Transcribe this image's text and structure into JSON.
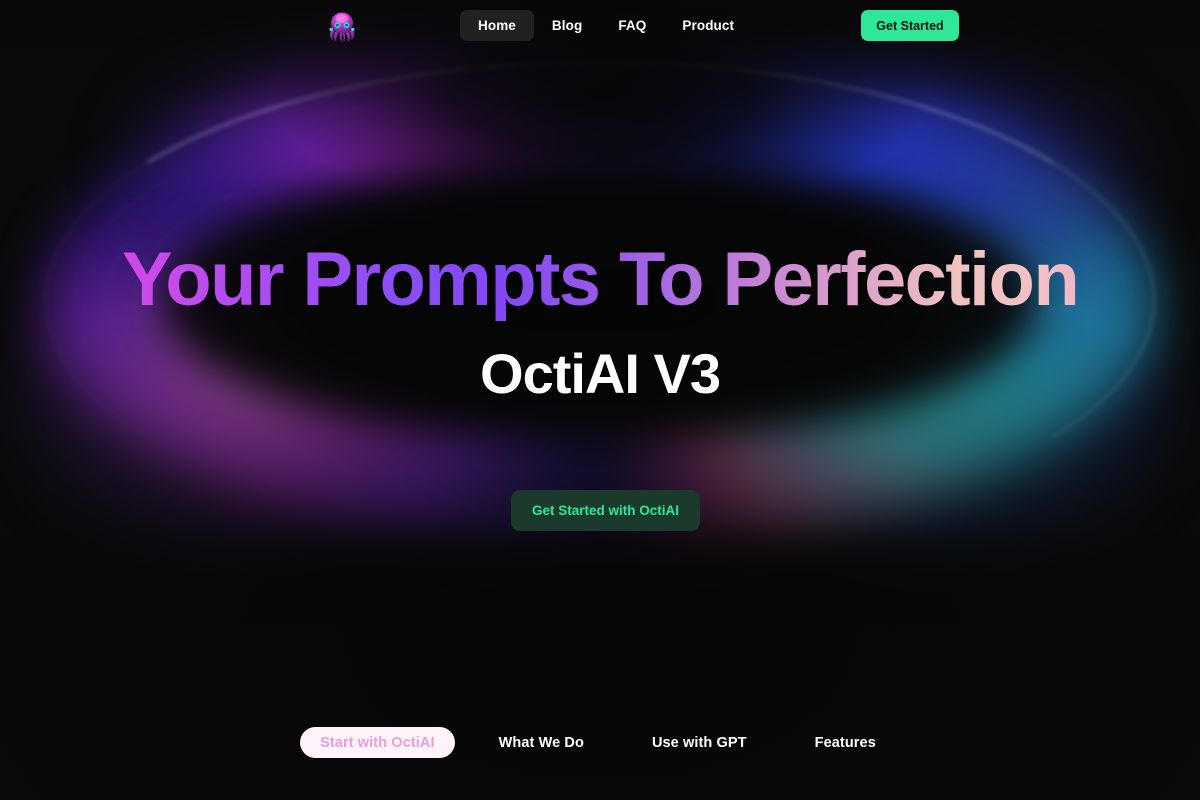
{
  "theme": {
    "page_bg": "#0a0a0a",
    "accent_green": "#2fe897",
    "cta_bg": "#1b3a2b",
    "nav_active_bg": "#212121",
    "tab_active_bg": "#fdf3fa",
    "tab_active_text": "#e79fd6",
    "headline_gradient_start": "#e24ae0",
    "headline_gradient_mid": "#8b4ef6",
    "headline_gradient_end": "#efa6c4"
  },
  "header": {
    "logo_icon": "octopus-logo-icon",
    "logo_alt": "OctiAI",
    "nav_items": [
      {
        "label": "Home",
        "active": true
      },
      {
        "label": "Blog",
        "active": false
      },
      {
        "label": "FAQ",
        "active": false
      },
      {
        "label": "Product",
        "active": false
      }
    ],
    "get_started_label": "Get Started"
  },
  "hero": {
    "headline": "Your Prompts To Perfection",
    "subheadline": "OctiAI V3",
    "cta_label": "Get Started with OctiAI"
  },
  "bottom_tabs": [
    {
      "label": "Start with OctiAI",
      "active": true
    },
    {
      "label": "What We Do",
      "active": false
    },
    {
      "label": "Use with GPT",
      "active": false
    },
    {
      "label": "Features",
      "active": false
    }
  ]
}
